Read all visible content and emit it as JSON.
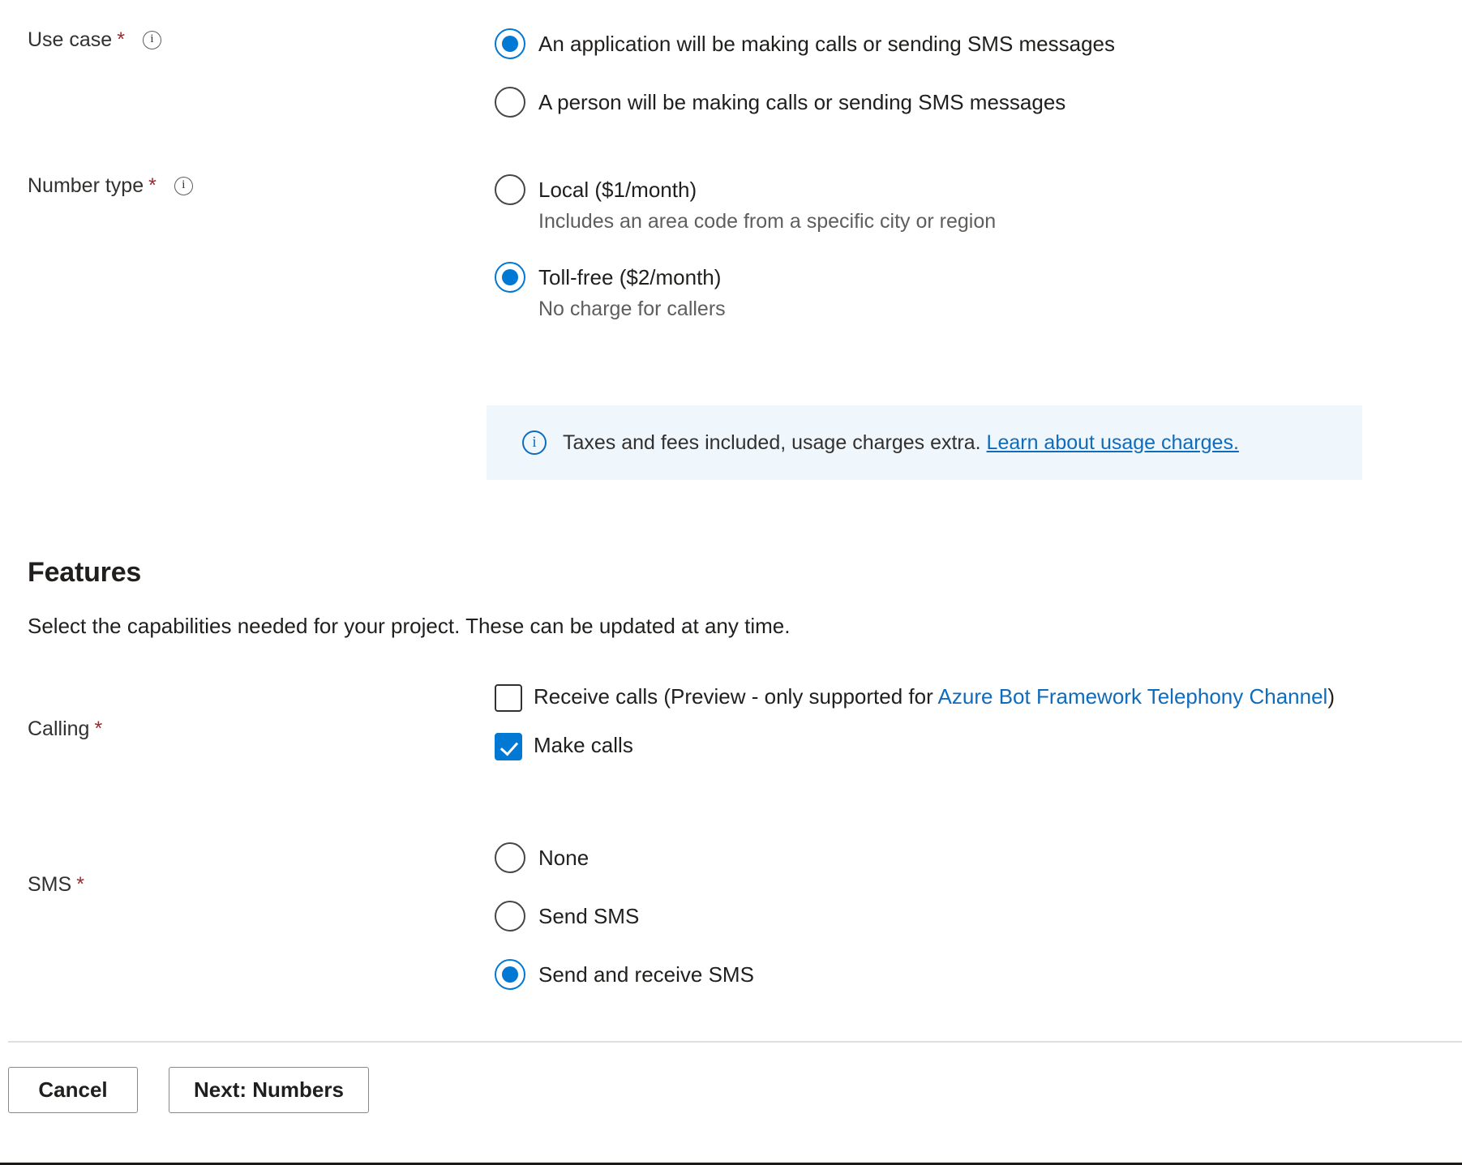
{
  "use_case": {
    "label": "Use case",
    "required_mark": "*",
    "info_icon": "i",
    "options": [
      {
        "label": "An application will be making calls or sending SMS messages",
        "selected": true
      },
      {
        "label": "A person will be making calls or sending SMS messages",
        "selected": false
      }
    ]
  },
  "number_type": {
    "label": "Number type",
    "required_mark": "*",
    "info_icon": "i",
    "options": [
      {
        "label": "Local ($1/month)",
        "description": "Includes an area code from a specific city or region",
        "selected": false
      },
      {
        "label": "Toll-free ($2/month)",
        "description": "No charge for callers",
        "selected": true
      }
    ]
  },
  "banner": {
    "icon": "i",
    "text": "Taxes and fees included, usage charges extra. ",
    "link_text": "Learn about usage charges.",
    "background": "#eff6fc",
    "accent": "#0f6cbd"
  },
  "features": {
    "title": "Features",
    "description": "Select the capabilities needed for your project. These can be updated at any time."
  },
  "calling": {
    "label": "Calling",
    "required_mark": "*",
    "options": [
      {
        "prefix": "Receive calls (Preview - only supported for ",
        "link_text": "Azure Bot Framework Telephony Channel",
        "suffix": ")",
        "checked": false
      },
      {
        "prefix": "Make calls",
        "link_text": "",
        "suffix": "",
        "checked": true
      }
    ]
  },
  "sms": {
    "label": "SMS",
    "required_mark": "*",
    "options": [
      {
        "label": "None",
        "selected": false
      },
      {
        "label": "Send SMS",
        "selected": false
      },
      {
        "label": "Send and receive SMS",
        "selected": true
      }
    ]
  },
  "footer": {
    "cancel_label": "Cancel",
    "next_label": "Next: Numbers"
  },
  "colors": {
    "accent": "#0078d4",
    "link": "#0f6cbd",
    "required": "#a4262c",
    "banner_bg": "#eff6fc"
  }
}
